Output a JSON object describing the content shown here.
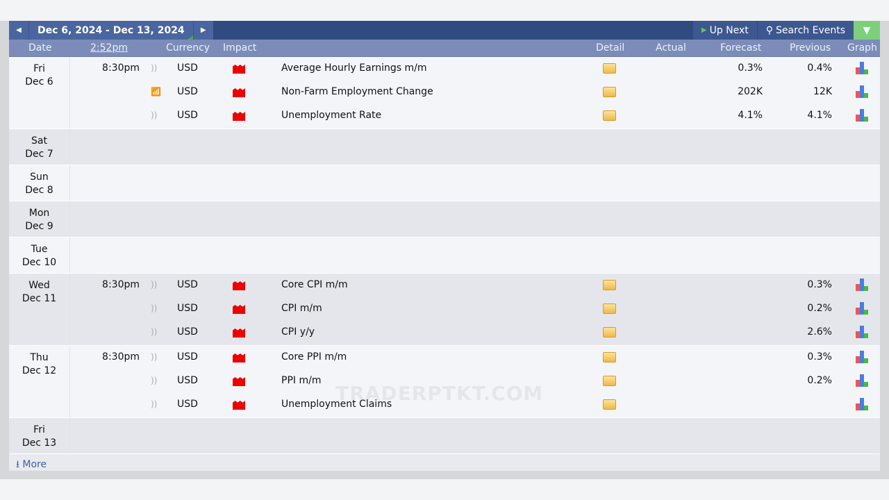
{
  "header": {
    "range": "Dec 6, 2024 - Dec 13, 2024",
    "up_next": "Up Next",
    "search": "Search Events"
  },
  "columns": {
    "date": "Date",
    "time": "2:52pm",
    "currency": "Currency",
    "impact": "Impact",
    "detail": "Detail",
    "actual": "Actual",
    "forecast": "Forecast",
    "previous": "Previous",
    "graph": "Graph"
  },
  "colors": {
    "topbar": "#2f4b80",
    "colhead": "#7b8cb8",
    "impact_high": "#e00000",
    "filter": "#7dd07a"
  },
  "days": [
    {
      "dow": "Fri",
      "date": "Dec 6",
      "events": [
        {
          "time": "8:30pm",
          "currency": "USD",
          "impact": "high",
          "name": "Average Hourly Earnings m/m",
          "actual": "",
          "forecast": "0.3%",
          "previous": "0.4%",
          "icon": "sound-icon"
        },
        {
          "time": "",
          "currency": "USD",
          "impact": "high",
          "name": "Non-Farm Employment Change",
          "actual": "",
          "forecast": "202K",
          "previous": "12K",
          "icon": "wifi-icon"
        },
        {
          "time": "",
          "currency": "USD",
          "impact": "high",
          "name": "Unemployment Rate",
          "actual": "",
          "forecast": "4.1%",
          "previous": "4.1%",
          "icon": "sound-icon"
        }
      ]
    },
    {
      "dow": "Sat",
      "date": "Dec 7",
      "events": []
    },
    {
      "dow": "Sun",
      "date": "Dec 8",
      "events": []
    },
    {
      "dow": "Mon",
      "date": "Dec 9",
      "events": []
    },
    {
      "dow": "Tue",
      "date": "Dec 10",
      "events": []
    },
    {
      "dow": "Wed",
      "date": "Dec 11",
      "events": [
        {
          "time": "8:30pm",
          "currency": "USD",
          "impact": "high",
          "name": "Core CPI m/m",
          "actual": "",
          "forecast": "",
          "previous": "0.3%",
          "icon": "sound-icon"
        },
        {
          "time": "",
          "currency": "USD",
          "impact": "high",
          "name": "CPI m/m",
          "actual": "",
          "forecast": "",
          "previous": "0.2%",
          "icon": "sound-icon"
        },
        {
          "time": "",
          "currency": "USD",
          "impact": "high",
          "name": "CPI y/y",
          "actual": "",
          "forecast": "",
          "previous": "2.6%",
          "icon": "sound-icon"
        }
      ]
    },
    {
      "dow": "Thu",
      "date": "Dec 12",
      "events": [
        {
          "time": "8:30pm",
          "currency": "USD",
          "impact": "high",
          "name": "Core PPI m/m",
          "actual": "",
          "forecast": "",
          "previous": "0.3%",
          "icon": "sound-icon"
        },
        {
          "time": "",
          "currency": "USD",
          "impact": "high",
          "name": "PPI m/m",
          "actual": "",
          "forecast": "",
          "previous": "0.2%",
          "icon": "sound-icon"
        },
        {
          "time": "",
          "currency": "USD",
          "impact": "high",
          "name": "Unemployment Claims",
          "actual": "",
          "forecast": "",
          "previous": "",
          "icon": "sound-icon"
        }
      ]
    },
    {
      "dow": "Fri",
      "date": "Dec 13",
      "events": []
    }
  ],
  "footer": {
    "more": "More"
  },
  "watermark": "TRADERPTKT.COM"
}
